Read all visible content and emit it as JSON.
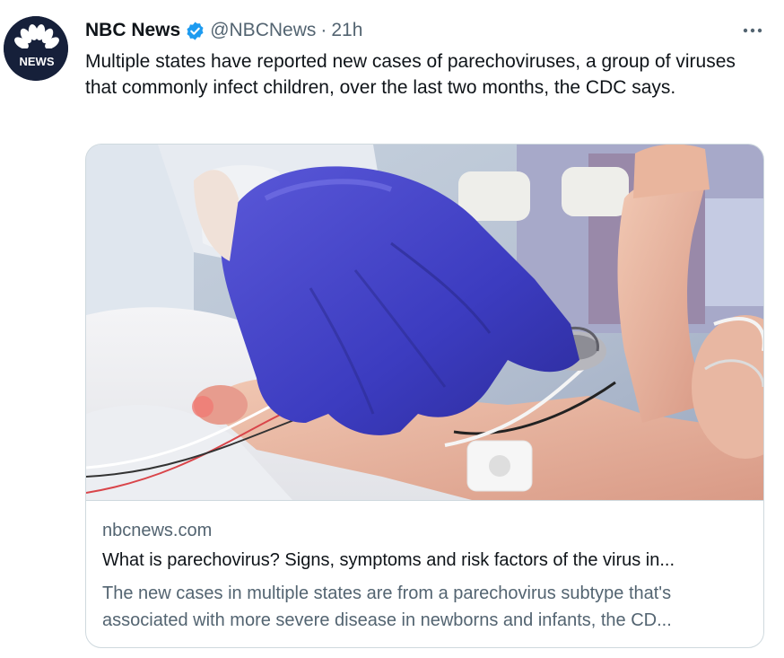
{
  "tweet": {
    "author_name": "NBC News",
    "handle": "@NBCNews",
    "separator": "·",
    "time": "21h",
    "avatar_text": "NEWS",
    "more_icon": "more-horizontal-icon",
    "verified_icon": "verified-badge-icon",
    "text": "Multiple states have reported new cases of parechoviruses, a group of viruses that commonly infect children, over the last two months, the CDC says.",
    "colors": {
      "verified": "#1d9bf0",
      "secondary_text": "#536471",
      "primary_text": "#0f1419",
      "avatar_bg": "#16203a"
    }
  },
  "card": {
    "domain": "nbcnews.com",
    "title": "What is parechovirus? Signs, symptoms and risk factors of the virus in...",
    "description": "The new cases in multiple states are from a parechovirus subtype that's associated with more severe disease in newborns and infants, the CD..."
  }
}
